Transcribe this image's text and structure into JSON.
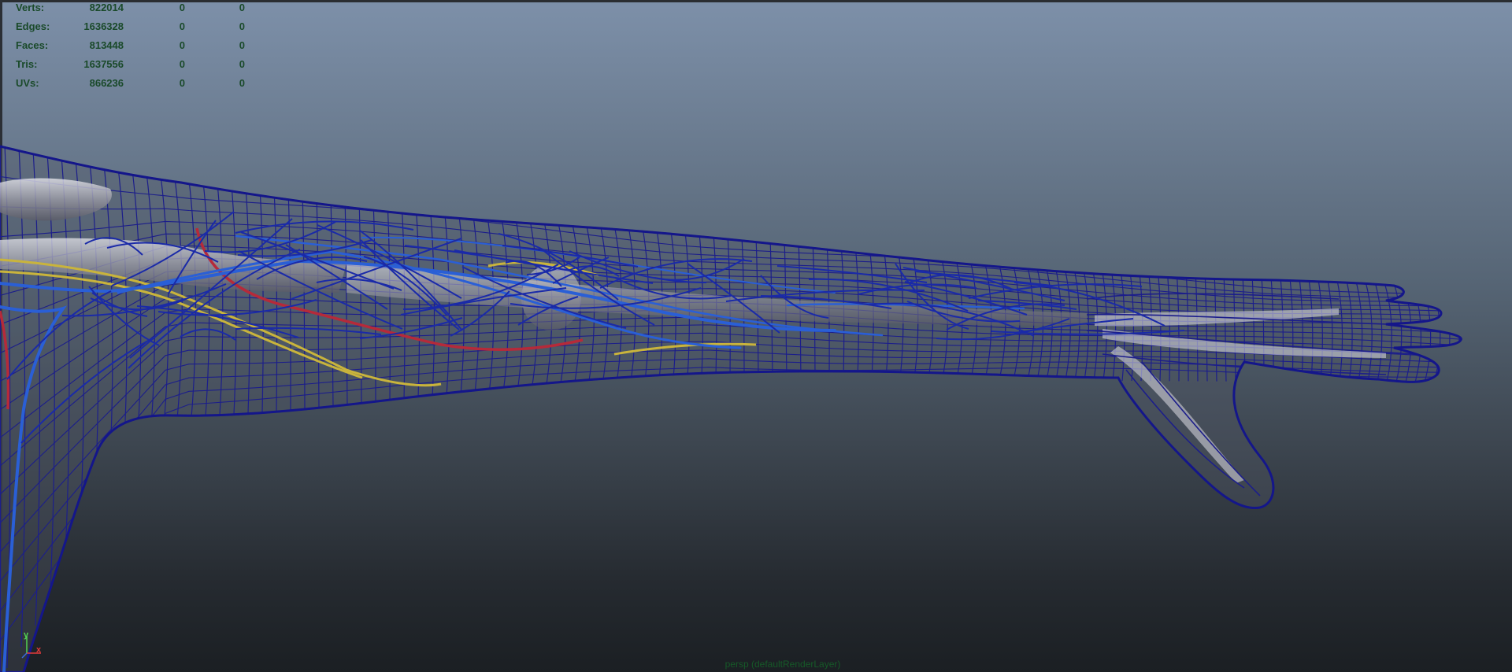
{
  "hud": {
    "rows": [
      {
        "label": "Verts:",
        "total": "822014",
        "selected": "0",
        "component": "0"
      },
      {
        "label": "Edges:",
        "total": "1636328",
        "selected": "0",
        "component": "0"
      },
      {
        "label": "Faces:",
        "total": "813448",
        "selected": "0",
        "component": "0"
      },
      {
        "label": "Tris:",
        "total": "1637556",
        "selected": "0",
        "component": "0"
      },
      {
        "label": "UVs:",
        "total": "866236",
        "selected": "0",
        "component": "0"
      }
    ]
  },
  "axis_gizmo": {
    "y_label": "y",
    "x_label": "x",
    "y_color": "#52d252",
    "x_color": "#e23a3a"
  },
  "camera_label": "persp (defaultRenderLayer)",
  "colors": {
    "wireframe": "#1c1e8a",
    "veins": "#2a5fd6",
    "arteries": "#b52a3a",
    "nerves": "#c9b43c",
    "bone": "#c9c9cf",
    "hud_text": "#1a4a2a"
  },
  "icons": [
    "axis-gizmo-icon"
  ]
}
